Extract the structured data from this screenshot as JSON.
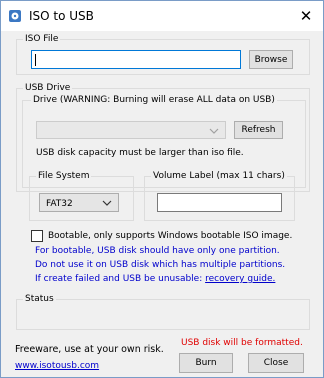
{
  "window": {
    "title": "ISO to USB",
    "close_glyph": "✕"
  },
  "iso_file": {
    "group_label": "ISO File",
    "path_value": "",
    "browse_label": "Browse"
  },
  "usb_drive": {
    "group_label": "USB Drive",
    "drive_label": "Drive (WARNING: Burning will erase ALL data on USB)",
    "drive_value": "",
    "refresh_label": "Refresh",
    "capacity_note": "USB disk capacity must be larger than iso file."
  },
  "file_system": {
    "group_label": "File System",
    "selected": "FAT32"
  },
  "volume_label": {
    "group_label": "Volume Label (max 11 chars)",
    "value": ""
  },
  "bootable": {
    "label": "Bootable, only supports Windows bootable ISO image.",
    "checked": false,
    "note_line1": "For bootable, USB disk should have only one partition.",
    "note_line2": "Do not use it on USB disk which has multiple partitions.",
    "note_line3_prefix": "If create failed and USB be unusable: ",
    "recovery_link": "recovery guide."
  },
  "status": {
    "group_label": "Status",
    "text": ""
  },
  "footer": {
    "freeware": "Freeware, use at your own risk.",
    "warning": "USB disk will be formatted.",
    "website": "www.isotousb.com",
    "burn_label": "Burn",
    "close_label": "Close"
  },
  "colors": {
    "link_blue": "#0000cc",
    "warning_red": "#e00000",
    "focus_border": "#0078d7"
  }
}
